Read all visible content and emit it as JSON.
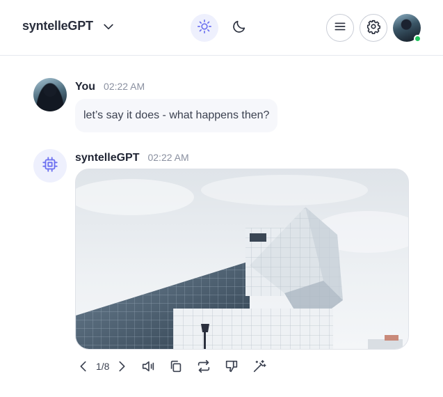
{
  "header": {
    "brand": "syntelleGPT",
    "icons": {
      "brand_menu": "chevron-down-icon",
      "light_theme": "sun-icon",
      "dark_theme": "moon-icon",
      "menu": "hamburger-menu-icon",
      "settings": "gear-icon",
      "profile": "avatar"
    },
    "online_status_color": "#22c55e"
  },
  "messages": [
    {
      "sender": "You",
      "time": "02:22 AM",
      "text": "let’s say it does - what happens then?"
    },
    {
      "sender": "syntelleGPT",
      "time": "02:22 AM",
      "attachment": "image",
      "attachment_subject": "modern angular glass building against cloudy sky"
    }
  ],
  "actions": {
    "pager": "1/8",
    "icons": [
      "chevron-left-icon",
      "chevron-right-icon",
      "speaker-icon",
      "copy-icon",
      "regenerate-icon",
      "thumbs-down-icon",
      "magic-wand-icon"
    ]
  },
  "colors": {
    "accent": "#6b6ff0",
    "accent_soft": "#eef0fd",
    "bubble_bg": "#f6f7fb",
    "text_muted": "#8a90a0"
  }
}
